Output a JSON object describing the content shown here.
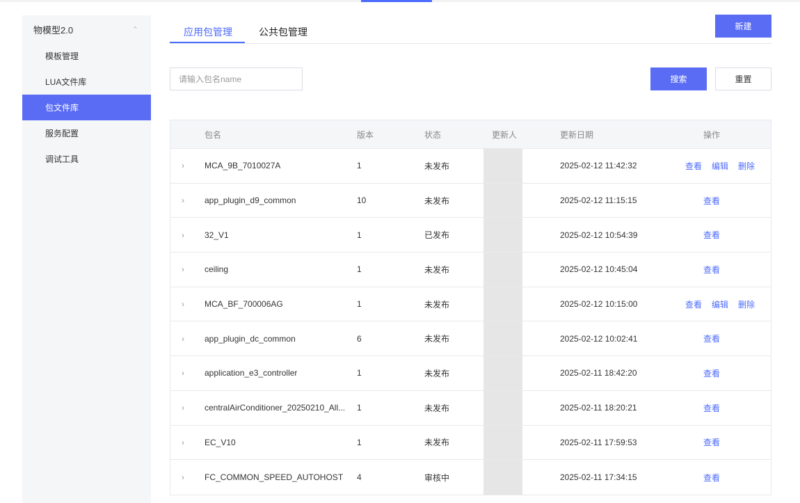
{
  "sidebar": {
    "group_label": "物模型2.0",
    "group_chevron": "chevron-up-icon",
    "items": [
      {
        "label": "模板管理",
        "active": false
      },
      {
        "label": "LUA文件库",
        "active": false
      },
      {
        "label": "包文件库",
        "active": true
      },
      {
        "label": "服务配置",
        "active": false
      },
      {
        "label": "调试工具",
        "active": false
      }
    ]
  },
  "tabs": [
    {
      "label": "应用包管理",
      "active": true
    },
    {
      "label": "公共包管理",
      "active": false
    }
  ],
  "toolbar": {
    "new_label": "新建",
    "search_placeholder": "请输入包名name",
    "search_value": "",
    "search_label": "搜索",
    "reset_label": "重置"
  },
  "table": {
    "columns": {
      "name": "包名",
      "version": "版本",
      "status": "状态",
      "updater": "更新人",
      "date": "更新日期",
      "ops": "操作"
    },
    "op_labels": {
      "view": "查看",
      "edit": "编辑",
      "delete": "删除"
    },
    "rows": [
      {
        "name": "MCA_9B_7010027A",
        "version": "1",
        "status": "未发布",
        "date": "2025-02-12 11:42:32",
        "ops": [
          "view",
          "edit",
          "delete"
        ]
      },
      {
        "name": "app_plugin_d9_common",
        "version": "10",
        "status": "未发布",
        "date": "2025-02-12 11:15:15",
        "ops": [
          "view"
        ]
      },
      {
        "name": "32_V1",
        "version": "1",
        "status": "已发布",
        "date": "2025-02-12 10:54:39",
        "ops": [
          "view"
        ]
      },
      {
        "name": "ceiling",
        "version": "1",
        "status": "未发布",
        "date": "2025-02-12 10:45:04",
        "ops": [
          "view"
        ]
      },
      {
        "name": "MCA_BF_700006AG",
        "version": "1",
        "status": "未发布",
        "date": "2025-02-12 10:15:00",
        "ops": [
          "view",
          "edit",
          "delete"
        ]
      },
      {
        "name": "app_plugin_dc_common",
        "version": "6",
        "status": "未发布",
        "date": "2025-02-12 10:02:41",
        "ops": [
          "view"
        ]
      },
      {
        "name": "application_e3_controller",
        "version": "1",
        "status": "未发布",
        "date": "2025-02-11 18:42:20",
        "ops": [
          "view"
        ]
      },
      {
        "name": "centralAirConditioner_20250210_All...",
        "version": "1",
        "status": "未发布",
        "date": "2025-02-11 18:20:21",
        "ops": [
          "view"
        ]
      },
      {
        "name": "EC_V10",
        "version": "1",
        "status": "未发布",
        "date": "2025-02-11 17:59:53",
        "ops": [
          "view"
        ]
      },
      {
        "name": "FC_COMMON_SPEED_AUTOHOST",
        "version": "4",
        "status": "审核中",
        "date": "2025-02-11 17:34:15",
        "ops": [
          "view"
        ]
      }
    ]
  },
  "colors": {
    "primary": "#5a6cf4",
    "link": "#4d6bfe",
    "sidebar_bg": "#f5f6f8",
    "header_bg": "#f5f6f8"
  }
}
